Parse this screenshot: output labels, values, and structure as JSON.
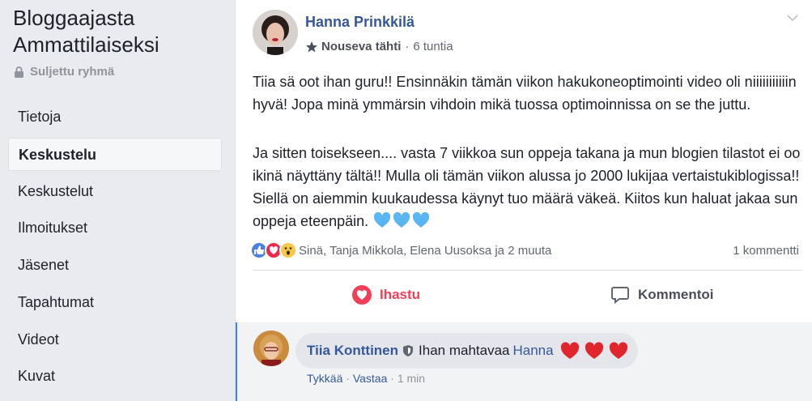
{
  "sidebar": {
    "group_title_line1": "Bloggaajasta",
    "group_title_line2": "Ammattilaiseksi",
    "group_type": "Suljettu ryhmä",
    "group_type_icon": "lock-icon",
    "items": [
      {
        "label": "Tietoja",
        "active": false
      },
      {
        "label": "Keskustelu",
        "active": true
      },
      {
        "label": "Keskustelut",
        "active": false
      },
      {
        "label": "Ilmoitukset",
        "active": false
      },
      {
        "label": "Jäsenet",
        "active": false
      },
      {
        "label": "Tapahtumat",
        "active": false
      },
      {
        "label": "Videot",
        "active": false
      },
      {
        "label": "Kuvat",
        "active": false
      }
    ]
  },
  "post": {
    "author": "Hanna Prinkkilä",
    "badge": "Nouseva tähti",
    "badge_icon": "star-icon",
    "time": "6 tuntia",
    "paragraph1": "Tiia sä oot ihan guru!! Ensinnäkin tämän viikon hakukoneoptimointi video oli niiiiiiiiiiin hyvä! Jopa minä ymmärsin vihdoin mikä tuossa optimoinnissa on se the juttu.",
    "paragraph2": "Ja sitten toisekseen.... vasta 7 viikkoa sun oppeja takana ja mun blogien tilastot ei oo ikinä näyttäny tältä!! Mulla oli tämän viikon alussa jo 2000 lukijaa vertaistukiblogissa!! Siellä on aiemmin kuukaudessa käynyt tuo määrä väkeä. Kiitos kun haluat jakaa sun oppeja eteenpäin.",
    "reactions_text": "Sinä, Tanja Mikkola, Elena Uusoksa ja 2 muuta",
    "comments_count": "1 kommentti",
    "like_action": "Ihastu",
    "comment_action": "Kommentoi"
  },
  "comment": {
    "author": "Tiia Konttinen",
    "text": "Ihan mahtavaa",
    "mention": "Hanna",
    "like": "Tykkää",
    "reply": "Vastaa",
    "time": "1 min"
  },
  "colors": {
    "link_blue": "#365899",
    "love_red": "#f33e58",
    "heart_blue": "#5ab6f0",
    "heart_red": "#e0262c"
  }
}
